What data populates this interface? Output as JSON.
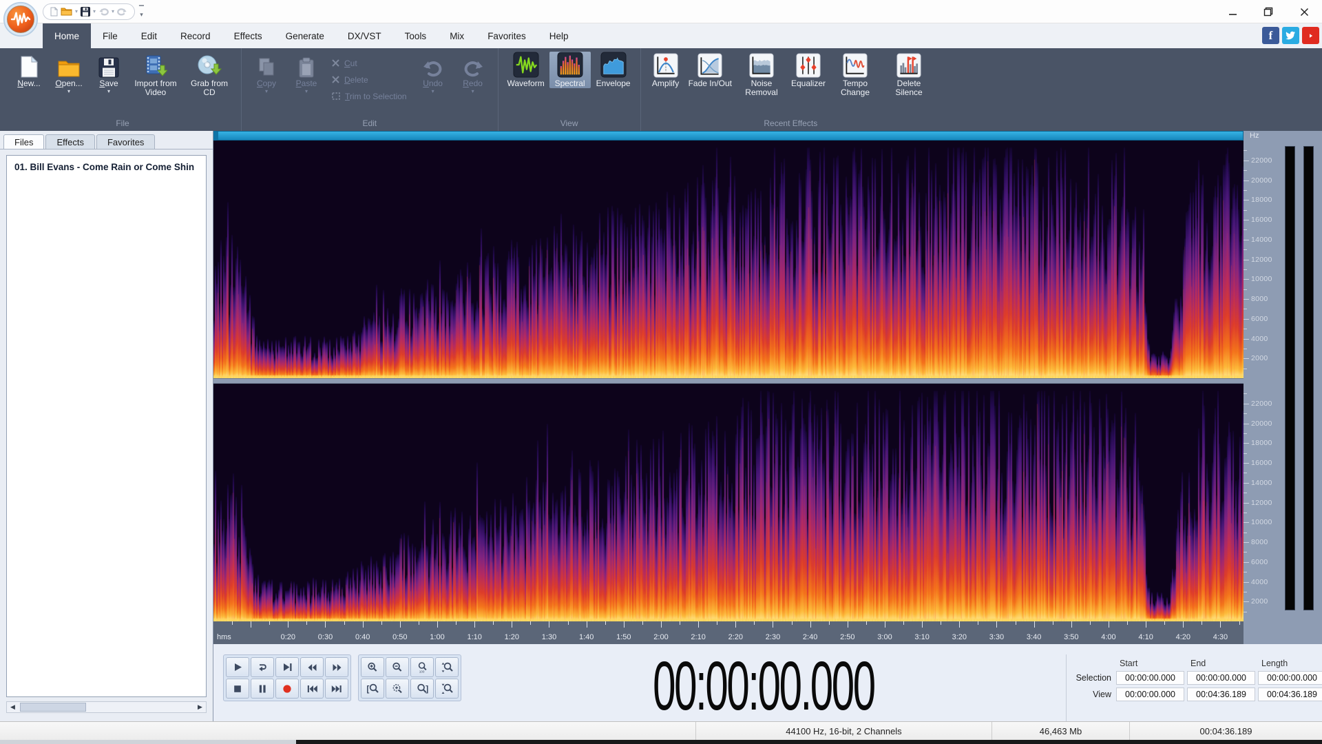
{
  "titlebar": {
    "quick_access_icons": [
      "new",
      "open",
      "save",
      "undo",
      "redo"
    ],
    "window_controls": [
      "minimize",
      "maximize",
      "close"
    ]
  },
  "menu": {
    "tabs": [
      "Home",
      "File",
      "Edit",
      "Record",
      "Effects",
      "Generate",
      "DX/VST",
      "Tools",
      "Mix",
      "Favorites",
      "Help"
    ],
    "active_tab": "Home"
  },
  "social_links": [
    "facebook",
    "twitter",
    "youtube"
  ],
  "ribbon": {
    "groups": [
      {
        "caption": "File",
        "buttons": [
          {
            "label": "New..."
          },
          {
            "label": "Open..."
          },
          {
            "label": "Save"
          },
          {
            "label": "Import from Video"
          },
          {
            "label": "Grab from CD"
          }
        ]
      },
      {
        "caption": "Edit",
        "copy": "Copy",
        "paste": "Paste",
        "stack": [
          "Cut",
          "Delete",
          "Trim to Selection"
        ],
        "undo": "Undo",
        "redo": "Redo"
      },
      {
        "caption": "View",
        "buttons": [
          {
            "label": "Waveform"
          },
          {
            "label": "Spectral",
            "selected": true
          },
          {
            "label": "Envelope"
          }
        ]
      },
      {
        "caption": "Recent Effects",
        "buttons": [
          {
            "label": "Amplify"
          },
          {
            "label": "Fade In/Out"
          },
          {
            "label": "Noise Removal"
          },
          {
            "label": "Equalizer"
          },
          {
            "label": "Tempo Change"
          },
          {
            "label": "Delete Silence"
          }
        ]
      }
    ]
  },
  "panel": {
    "tabs": [
      "Files",
      "Effects",
      "Favorites"
    ],
    "active_tab": "Files",
    "files": [
      "01. Bill Evans - Come Rain or Come Shin"
    ]
  },
  "spectral_view": {
    "channels": 2,
    "freq_unit": "Hz",
    "freq_labels": [
      22000,
      20000,
      18000,
      16000,
      14000,
      12000,
      10000,
      8000,
      6000,
      4000,
      2000
    ],
    "freq_max": 24000,
    "palette": [
      "#ffe98f",
      "#fdba3a",
      "#f4761b",
      "#dd3d2a",
      "#b42a62",
      "#7e2482",
      "#491778",
      "#250b52",
      "#12052b"
    ],
    "background": "#0d031b",
    "envelope_keys": [
      [
        0,
        0.45
      ],
      [
        0.02,
        0.5
      ],
      [
        0.045,
        0.14
      ],
      [
        0.12,
        0.15
      ],
      [
        0.18,
        0.3
      ],
      [
        0.3,
        0.48
      ],
      [
        0.42,
        0.62
      ],
      [
        0.52,
        0.8
      ],
      [
        0.62,
        0.78
      ],
      [
        0.72,
        0.84
      ],
      [
        0.82,
        0.8
      ],
      [
        0.88,
        0.78
      ],
      [
        0.9,
        0.55
      ],
      [
        0.908,
        0.12
      ],
      [
        0.928,
        0.09
      ],
      [
        0.94,
        0.55
      ],
      [
        0.955,
        0.78
      ],
      [
        0.985,
        0.8
      ],
      [
        1,
        0.7
      ]
    ]
  },
  "ruler": {
    "unit_label": "hms",
    "duration_seconds": 276.189,
    "labels": [
      "0:20",
      "0:30",
      "0:40",
      "0:50",
      "1:00",
      "1:10",
      "1:20",
      "1:30",
      "1:40",
      "1:50",
      "2:00",
      "2:10",
      "2:20",
      "2:30",
      "2:40",
      "2:50",
      "3:00",
      "3:10",
      "3:20",
      "3:30",
      "3:40",
      "3:50",
      "4:00",
      "4:10",
      "4:20",
      "4:30"
    ]
  },
  "transport": {
    "rows": [
      [
        "play",
        "loop",
        "play-to-end",
        "rewind",
        "fast-forward"
      ],
      [
        "stop",
        "pause",
        "record",
        "go-to-start",
        "go-to-end"
      ]
    ]
  },
  "zoomgrid": {
    "rows": [
      [
        "zoom-in",
        "zoom-out",
        "zoom-100",
        "zoom-vertical-in"
      ],
      [
        "zoom-selection-start",
        "zoom-selection",
        "zoom-selection-end",
        "zoom-vertical-out"
      ]
    ]
  },
  "time_display": {
    "value": "00:00:00.000"
  },
  "selection_grid": {
    "col_headers": [
      "Start",
      "End",
      "Length"
    ],
    "rows": [
      {
        "label": "Selection",
        "values": [
          "00:00:00.000",
          "00:00:00.000",
          "00:00:00.000"
        ]
      },
      {
        "label": "View",
        "values": [
          "00:00:00.000",
          "00:04:36.189",
          "00:04:36.189"
        ]
      }
    ]
  },
  "status_bar": {
    "format": "44100 Hz, 16-bit, 2 Channels",
    "size": "46,463 Mb",
    "length": "00:04:36.189"
  },
  "colors": {
    "ribbon_bg": "#4a5466",
    "accent_scrollbar_blue": "#1b93c8",
    "record_red": "#e03020",
    "axis_bg": "#8e9cb3"
  }
}
